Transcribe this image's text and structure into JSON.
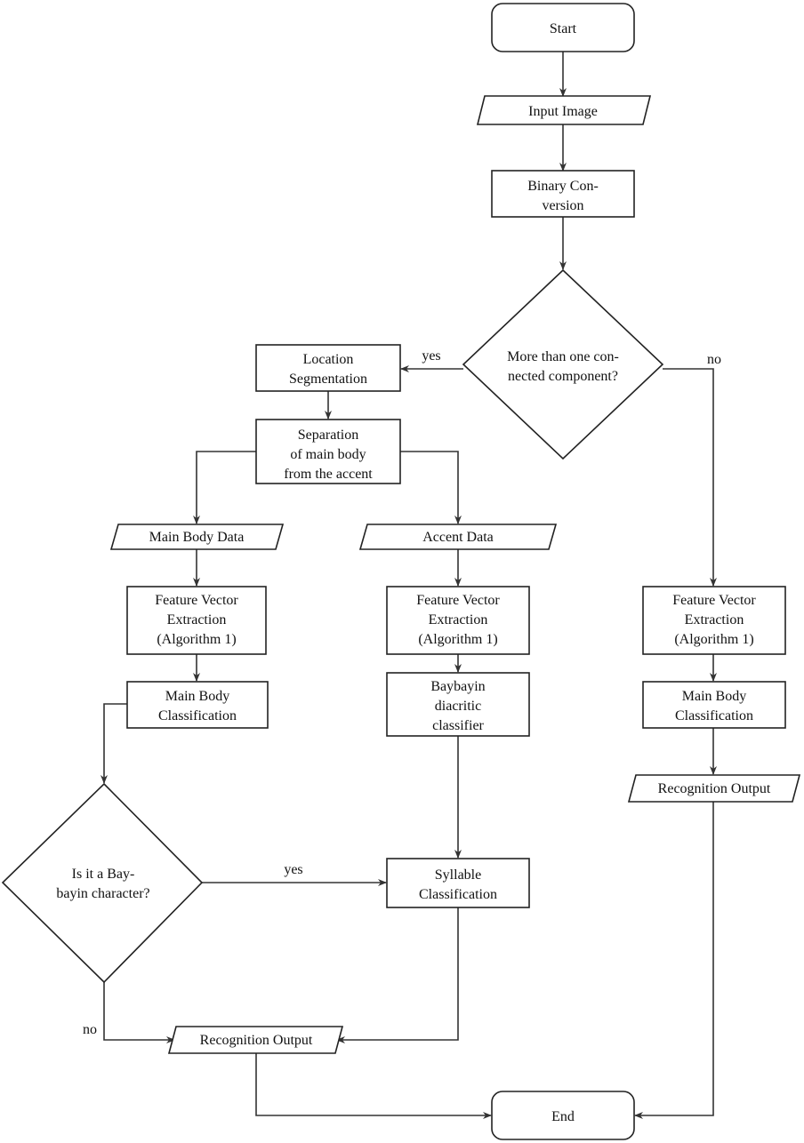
{
  "nodes": {
    "start": [
      "Start"
    ],
    "input_image": [
      "Input Image"
    ],
    "binary_conversion": [
      "Binary Con-",
      "version"
    ],
    "decision_components": [
      "More than one con-",
      "nected component?"
    ],
    "location_segmentation": [
      "Location",
      "Segmentation"
    ],
    "separation": [
      "Separation",
      "of main body",
      "from the accent"
    ],
    "main_body_data": [
      "Main Body Data"
    ],
    "accent_data": [
      "Accent Data"
    ],
    "fve_left": [
      "Feature Vector",
      "Extraction",
      "(Algorithm 1)"
    ],
    "fve_mid": [
      "Feature Vector",
      "Extraction",
      "(Algorithm 1)"
    ],
    "fve_right": [
      "Feature Vector",
      "Extraction",
      "(Algorithm 1)"
    ],
    "mbc_left": [
      "Main Body",
      "Classification"
    ],
    "diacritic_classifier": [
      "Baybayin",
      "diacritic",
      "classifier"
    ],
    "mbc_right": [
      "Main Body",
      "Classification"
    ],
    "recognition_output_right": [
      "Recognition Output"
    ],
    "decision_baybayin": [
      "Is it a Bay-",
      "bayin character?"
    ],
    "syllable_classification": [
      "Syllable",
      "Classification"
    ],
    "recognition_output_bottom": [
      "Recognition Output"
    ],
    "end": [
      "End"
    ]
  },
  "edge_labels": {
    "components_yes": "yes",
    "components_no": "no",
    "baybayin_yes": "yes",
    "baybayin_no": "no"
  }
}
